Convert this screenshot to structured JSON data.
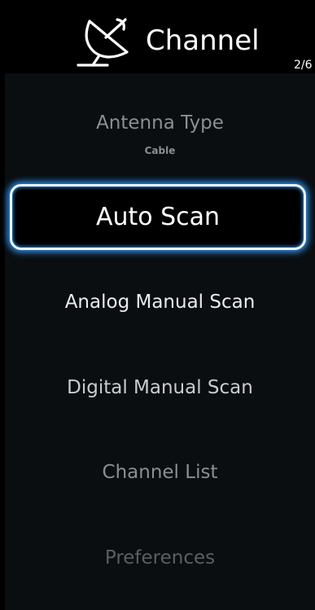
{
  "header": {
    "icon": "satellite-dish-icon",
    "title": "Channel",
    "page_indicator": "2/6"
  },
  "menu": {
    "antenna_type": {
      "label": "Antenna Type",
      "value": "Cable"
    },
    "selected_item": "Auto Scan",
    "items": [
      "Analog Manual Scan",
      "Digital Manual Scan",
      "Channel List",
      "Preferences"
    ]
  },
  "colors": {
    "background": "#000000",
    "panel": "#0a0e11",
    "focus_glow": "#2f8ee6",
    "text_active": "#ffffff",
    "text_dim": "#8a8f93",
    "text_dimmer": "#5a5f63"
  }
}
